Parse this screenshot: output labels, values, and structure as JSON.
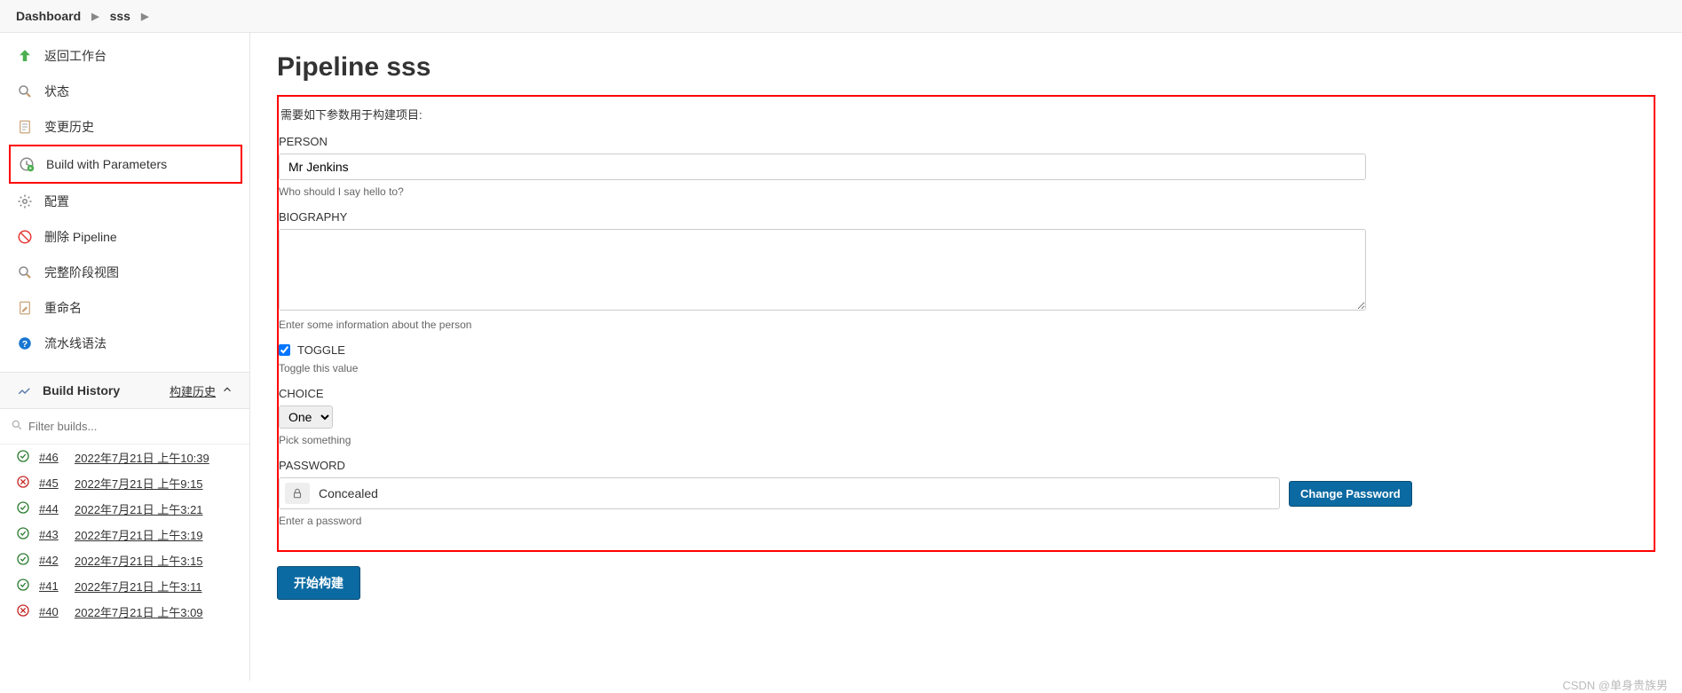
{
  "breadcrumbs": {
    "items": [
      "Dashboard",
      "sss"
    ]
  },
  "sidebar": {
    "items": [
      {
        "id": "back",
        "label": "返回工作台",
        "icon": "up-arrow-icon"
      },
      {
        "id": "status",
        "label": "状态",
        "icon": "search-icon"
      },
      {
        "id": "changes",
        "label": "变更历史",
        "icon": "document-icon"
      },
      {
        "id": "build-params",
        "label": "Build with Parameters",
        "icon": "clock-play-icon",
        "highlighted": true
      },
      {
        "id": "configure",
        "label": "配置",
        "icon": "gear-icon"
      },
      {
        "id": "delete",
        "label": "删除 Pipeline",
        "icon": "no-entry-icon"
      },
      {
        "id": "full-stage",
        "label": "完整阶段视图",
        "icon": "search-icon"
      },
      {
        "id": "rename",
        "label": "重命名",
        "icon": "document-edit-icon"
      },
      {
        "id": "syntax",
        "label": "流水线语法",
        "icon": "help-icon"
      }
    ],
    "build_history": {
      "title": "Build History",
      "trend_label": "构建历史",
      "filter_placeholder": "Filter builds...",
      "builds": [
        {
          "num": "#46",
          "time": "2022年7月21日 上午10:39",
          "status": "ok"
        },
        {
          "num": "#45",
          "time": "2022年7月21日 上午9:15",
          "status": "fail"
        },
        {
          "num": "#44",
          "time": "2022年7月21日 上午3:21",
          "status": "ok"
        },
        {
          "num": "#43",
          "time": "2022年7月21日 上午3:19",
          "status": "ok"
        },
        {
          "num": "#42",
          "time": "2022年7月21日 上午3:15",
          "status": "ok"
        },
        {
          "num": "#41",
          "time": "2022年7月21日 上午3:11",
          "status": "ok"
        },
        {
          "num": "#40",
          "time": "2022年7月21日 上午3:09",
          "status": "fail"
        }
      ]
    }
  },
  "main": {
    "title": "Pipeline sss",
    "intro": "需要如下参数用于构建项目:",
    "params": {
      "person": {
        "label": "PERSON",
        "value": "Mr Jenkins",
        "help": "Who should I say hello to?"
      },
      "biography": {
        "label": "BIOGRAPHY",
        "value": "",
        "help": "Enter some information about the person"
      },
      "toggle": {
        "label": "TOGGLE",
        "checked": true,
        "help": "Toggle this value"
      },
      "choice": {
        "label": "CHOICE",
        "selected": "One",
        "help": "Pick something"
      },
      "password": {
        "label": "PASSWORD",
        "display": "Concealed",
        "help": "Enter a password",
        "change_label": "Change Password"
      }
    },
    "build_button": "开始构建"
  },
  "watermark": "CSDN @单身贵族男"
}
